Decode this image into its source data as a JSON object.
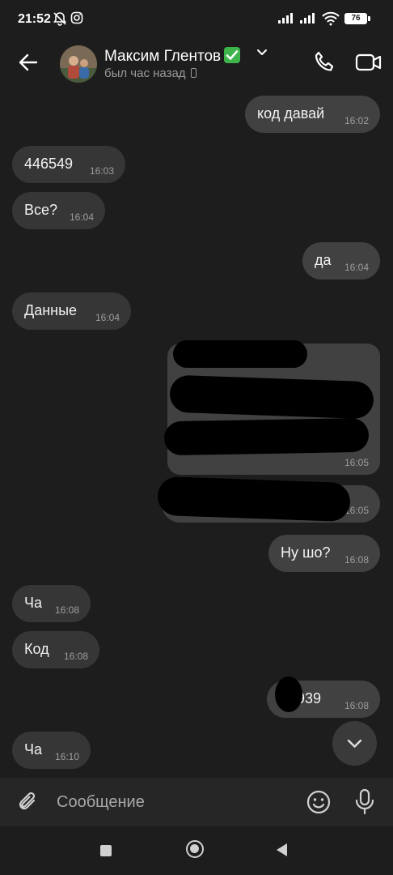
{
  "status_bar": {
    "time": "21:52",
    "battery": "76"
  },
  "header": {
    "name": "Максим Глентов",
    "status": "был час назад"
  },
  "messages": [
    {
      "dir": "out",
      "text": "код давай",
      "time": "16:02"
    },
    {
      "dir": "in",
      "text": "446549",
      "time": "16:03"
    },
    {
      "dir": "in",
      "text": "Все?",
      "time": "16:04"
    },
    {
      "dir": "out",
      "text": "да",
      "time": "16:04"
    },
    {
      "dir": "in",
      "text": "Данные",
      "time": "16:04"
    },
    {
      "dir": "out",
      "text": "[redacted]",
      "time": "16:05"
    },
    {
      "dir": "out",
      "text": "[redacted]",
      "time": "16:05"
    },
    {
      "dir": "out",
      "text": "Ну шо?",
      "time": "16:08"
    },
    {
      "dir": "in",
      "text": "Ча",
      "time": "16:08"
    },
    {
      "dir": "in",
      "text": "Код",
      "time": "16:08"
    },
    {
      "dir": "out",
      "text": "939",
      "time": "16:08"
    },
    {
      "dir": "in",
      "text": "Ча",
      "time": "16:10"
    }
  ],
  "composer": {
    "placeholder": "Сообщение"
  },
  "colors": {
    "background": "#1d1d1d",
    "bubble_in": "#363636",
    "bubble_out": "#414141",
    "verified": "#3db54a"
  },
  "icons": [
    "back-arrow-icon",
    "verified-check-icon",
    "chevron-down-icon",
    "phone-icon",
    "video-camera-icon",
    "paperclip-icon",
    "emoji-icon",
    "microphone-icon",
    "scroll-down-icon"
  ]
}
